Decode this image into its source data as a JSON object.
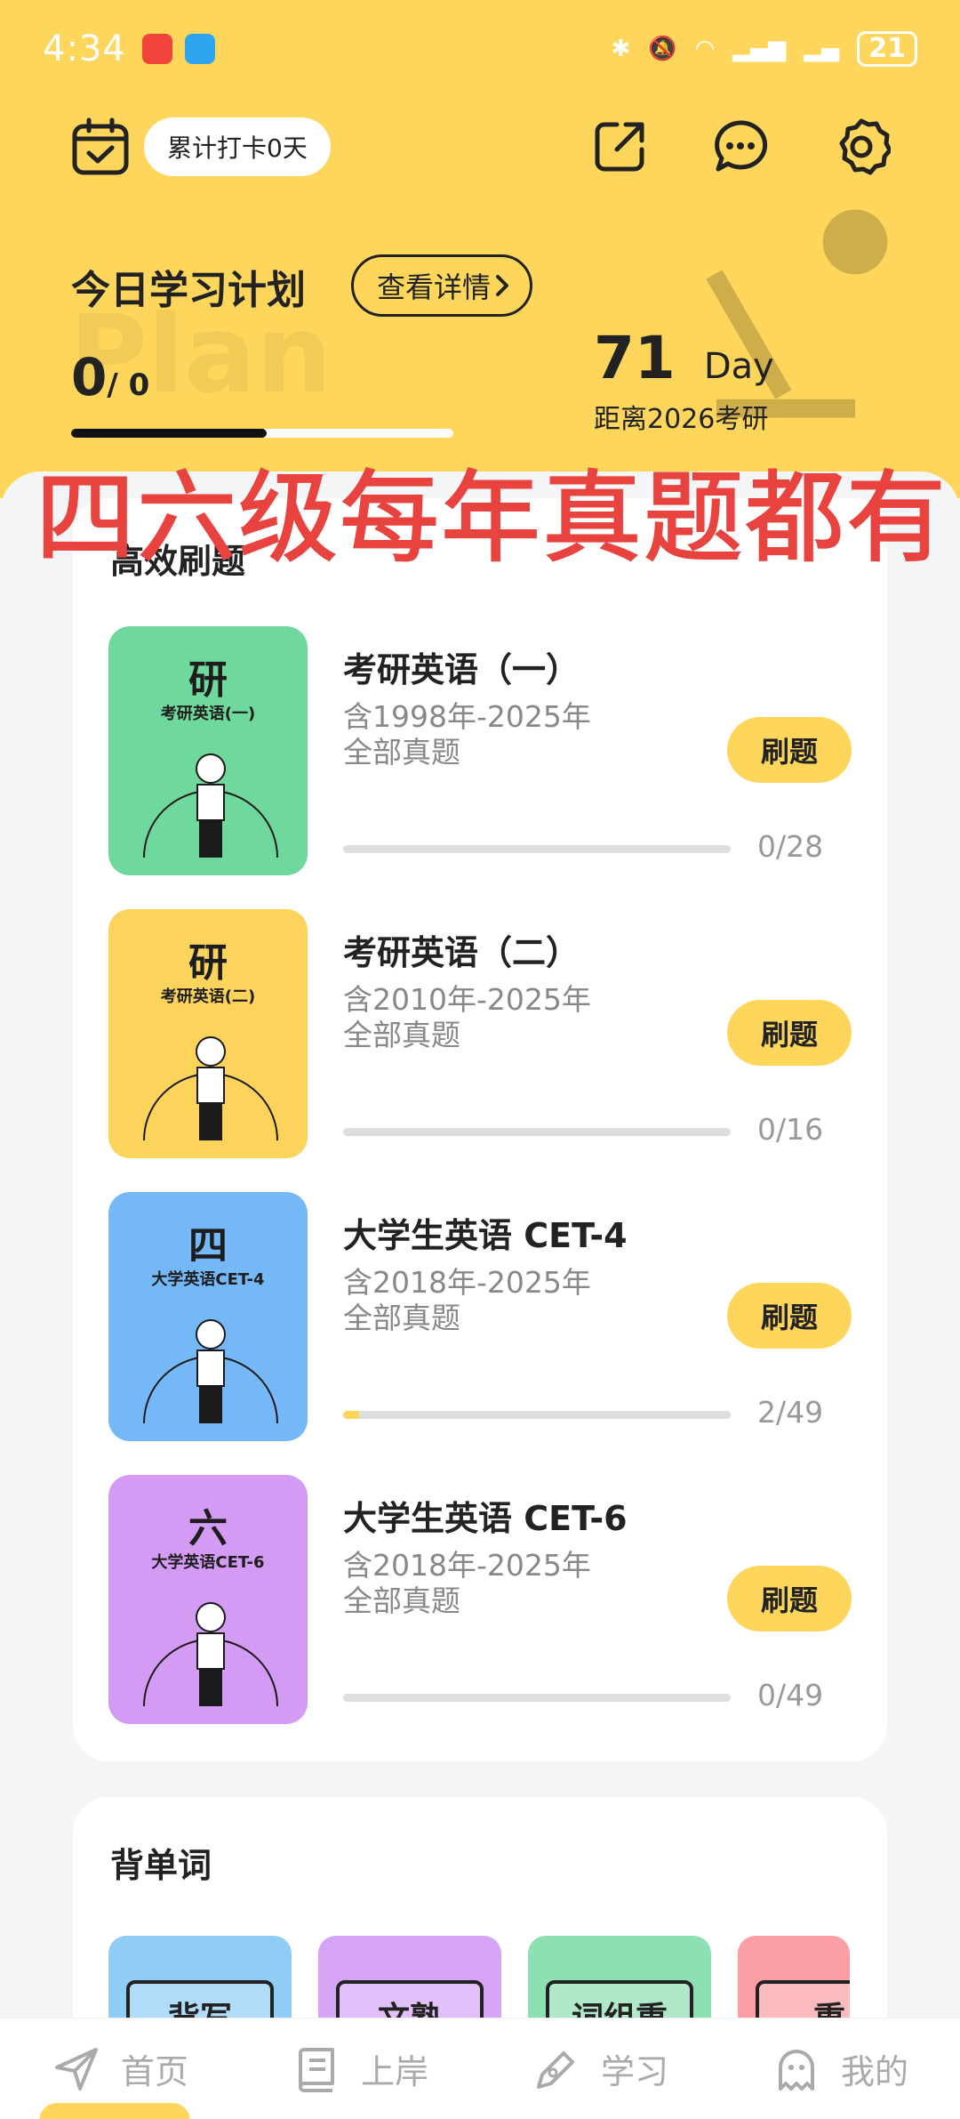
{
  "status_bar": {
    "time": "4:34",
    "battery": "21"
  },
  "header": {
    "checkin_label": "累计打卡0天"
  },
  "plan": {
    "title": "今日学习计划",
    "detail_label": "查看详情",
    "bg_word": "Plan",
    "done": "0",
    "total": "/ 0",
    "days": "71",
    "days_unit": "Day",
    "days_caption": "距离2026考研"
  },
  "banner": "四六级每年真题都有",
  "practice": {
    "title": "高效刷题",
    "items": [
      {
        "thumb_big": "研",
        "thumb_small": "考研英语(一)",
        "title": "考研英语（一）",
        "sub1": "含1998年-2025年",
        "sub2": "全部真题",
        "button": "刷题",
        "progress_text": "0/28",
        "done": 0,
        "total": 28,
        "color": "#6fd99d"
      },
      {
        "thumb_big": "研",
        "thumb_small": "考研英语(二)",
        "title": "考研英语（二）",
        "sub1": "含2010年-2025年",
        "sub2": "全部真题",
        "button": "刷题",
        "progress_text": "0/16",
        "done": 0,
        "total": 16,
        "color": "#fcd35b"
      },
      {
        "thumb_big": "四",
        "thumb_small": "大学英语CET-4",
        "title": "大学生英语 CET-4",
        "sub1": "含2018年-2025年",
        "sub2": "全部真题",
        "button": "刷题",
        "progress_text": "2/49",
        "done": 2,
        "total": 49,
        "color": "#74b8f8"
      },
      {
        "thumb_big": "六",
        "thumb_small": "大学英语CET-6",
        "title": "大学生英语 CET-6",
        "sub1": "含2018年-2025年",
        "sub2": "全部真题",
        "button": "刷题",
        "progress_text": "0/49",
        "done": 0,
        "total": 49,
        "color": "#d49bf5"
      }
    ]
  },
  "words": {
    "title": "背单词",
    "books": [
      {
        "label": "背写",
        "color": "#8fcdf6"
      },
      {
        "label": "文熟",
        "color": "#d6a4f5"
      },
      {
        "label": "词组重",
        "color": "#8ee0b3"
      },
      {
        "label": "重",
        "color": "#fb9fa4"
      }
    ]
  },
  "nav": {
    "items": [
      {
        "label": "首页",
        "icon": "send-icon"
      },
      {
        "label": "上岸",
        "icon": "book-icon"
      },
      {
        "label": "学习",
        "icon": "pen-icon"
      },
      {
        "label": "我的",
        "icon": "ghost-icon"
      }
    ]
  },
  "colors": {
    "accent": "#fdd65b",
    "banner": "#e8433f"
  }
}
